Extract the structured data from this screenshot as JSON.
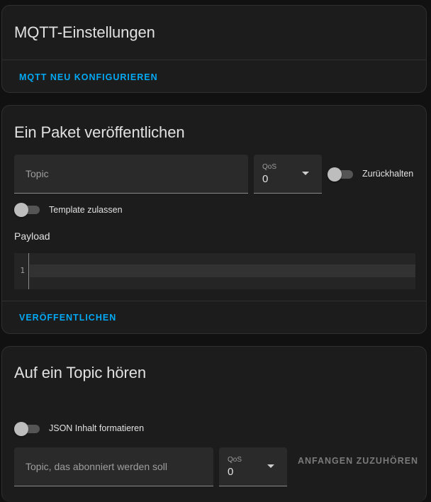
{
  "settings_card": {
    "title": "MQTT-Einstellungen",
    "reconfigure_label": "MQTT NEU KONFIGURIEREN"
  },
  "publish_card": {
    "title": "Ein Paket veröffentlichen",
    "topic_placeholder": "Topic",
    "qos_label": "QoS",
    "qos_value": "0",
    "retain_label": "Zurückhalten",
    "retain_on": false,
    "template_label": "Template zulassen",
    "template_on": false,
    "payload_label": "Payload",
    "editor_line_number": "1",
    "publish_label": "VERÖFFENTLICHEN"
  },
  "listen_card": {
    "title": "Auf ein Topic hören",
    "format_json_label": "JSON Inhalt formatieren",
    "format_json_on": false,
    "topic_placeholder": "Topic, das abonniert werden soll",
    "qos_label": "QoS",
    "qos_value": "0",
    "start_listening_label": "ANFANGEN ZUZUHÖREN"
  },
  "colors": {
    "accent": "#03a9f4",
    "card_bg": "#1c1c1c",
    "page_bg": "#111111"
  }
}
